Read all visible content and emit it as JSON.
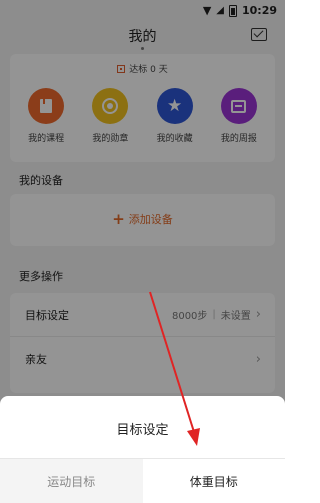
{
  "status_bar": {
    "time": "10:29"
  },
  "header": {
    "title": "我的",
    "message_icon": "message-icon"
  },
  "summary": {
    "goal_text": "达标 0 天"
  },
  "quick_actions": [
    {
      "label": "我的课程",
      "icon": "book-icon",
      "color": "#f06a2e"
    },
    {
      "label": "我的勋章",
      "icon": "medal-icon",
      "color": "#f2c220"
    },
    {
      "label": "我的收藏",
      "icon": "star-icon",
      "color": "#2e56d6"
    },
    {
      "label": "我的周报",
      "icon": "report-icon",
      "color": "#9b35d6"
    }
  ],
  "devices": {
    "section_title": "我的设备",
    "add_label": "添加设备"
  },
  "more": {
    "section_title": "更多操作",
    "target": {
      "label": "目标设定",
      "steps": "8000步",
      "sep": "|",
      "status": "未设置"
    },
    "friends": {
      "label": "亲友"
    }
  },
  "sheet": {
    "title": "目标设定",
    "options": [
      {
        "label": "运动目标",
        "selected": false
      },
      {
        "label": "体重目标",
        "selected": true
      }
    ]
  },
  "colors": {
    "accent": "#e36a2a",
    "annotation": "#e02424"
  }
}
